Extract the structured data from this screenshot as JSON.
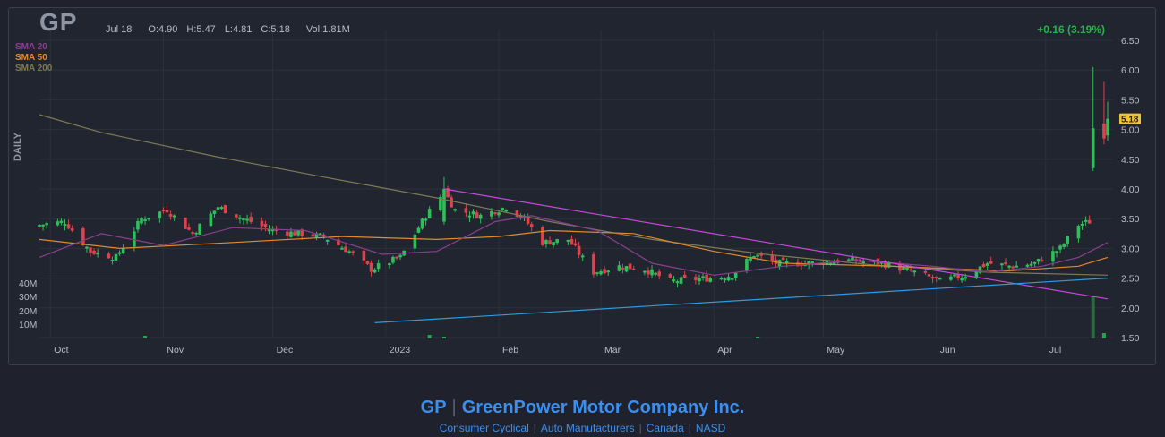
{
  "header": {
    "ticker": "GP",
    "date": "Jul 18",
    "open": "O:4.90",
    "high": "H:5.47",
    "low": "L:4.81",
    "close": "C:5.18",
    "volume": "Vol:1.81M",
    "change": "+0.16 (3.19%)",
    "timeframe": "DAILY"
  },
  "legend": [
    {
      "label": "SMA 20",
      "color": "#8a3f8f"
    },
    {
      "label": "SMA 50",
      "color": "#e08a2c"
    },
    {
      "label": "SMA 200",
      "color": "#7d7a55"
    }
  ],
  "footer": {
    "symbol": "GP",
    "company": "GreenPower Motor Company Inc.",
    "sector": "Consumer Cyclical",
    "industry": "Auto Manufacturers",
    "country": "Canada",
    "exchange": "NASD"
  },
  "colors": {
    "up": "#2fbf5a",
    "down": "#e0414d",
    "trendline_top": "#c64ad6",
    "trendline_bottom": "#2e9be0",
    "price_tag": "#f0c330"
  },
  "chart_data": {
    "type": "candlestick",
    "price_axis": {
      "ticks": [
        "6.50",
        "6.00",
        "5.50",
        "5.00",
        "4.50",
        "4.00",
        "3.50",
        "3.00",
        "2.50",
        "2.00",
        "1.50"
      ],
      "range": [
        1.5,
        6.5
      ]
    },
    "volume_axis": {
      "ticks": [
        "40M",
        "30M",
        "20M",
        "10M"
      ]
    },
    "x_labels": [
      "Oct",
      "Nov",
      "Dec",
      "2023",
      "Feb",
      "Mar",
      "Apr",
      "May",
      "Jun",
      "Jul"
    ],
    "last_price": "5.18",
    "anchors": [
      [
        "2022-09-28",
        3.4
      ],
      [
        "2022-10-05",
        3.45
      ],
      [
        "2022-10-12",
        2.95
      ],
      [
        "2022-10-19",
        2.85
      ],
      [
        "2022-10-26",
        3.5
      ],
      [
        "2022-11-02",
        3.65
      ],
      [
        "2022-11-09",
        3.25
      ],
      [
        "2022-11-16",
        3.7
      ],
      [
        "2022-11-23",
        3.5
      ],
      [
        "2022-12-01",
        3.3
      ],
      [
        "2022-12-08",
        3.25
      ],
      [
        "2022-12-15",
        3.2
      ],
      [
        "2022-12-22",
        2.95
      ],
      [
        "2022-12-28",
        2.65
      ],
      [
        "2023-01-05",
        2.85
      ],
      [
        "2023-01-12",
        3.55
      ],
      [
        "2023-01-17",
        3.95
      ],
      [
        "2023-01-20",
        3.65
      ],
      [
        "2023-01-27",
        3.55
      ],
      [
        "2023-02-03",
        3.7
      ],
      [
        "2023-02-08",
        3.5
      ],
      [
        "2023-02-13",
        3.1
      ],
      [
        "2023-02-20",
        3.15
      ],
      [
        "2023-02-27",
        2.6
      ],
      [
        "2023-03-06",
        2.7
      ],
      [
        "2023-03-13",
        2.65
      ],
      [
        "2023-03-20",
        2.45
      ],
      [
        "2023-03-31",
        2.5
      ],
      [
        "2023-04-06",
        2.55
      ],
      [
        "2023-04-12",
        2.9
      ],
      [
        "2023-04-18",
        2.75
      ],
      [
        "2023-04-26",
        2.75
      ],
      [
        "2023-05-08",
        2.8
      ],
      [
        "2023-05-17",
        2.75
      ],
      [
        "2023-05-26",
        2.6
      ],
      [
        "2023-06-02",
        2.45
      ],
      [
        "2023-06-09",
        2.55
      ],
      [
        "2023-06-15",
        2.75
      ],
      [
        "2023-06-22",
        2.7
      ],
      [
        "2023-06-28",
        2.75
      ],
      [
        "2023-07-05",
        3.0
      ],
      [
        "2023-07-10",
        3.4
      ],
      [
        "2023-07-13",
        3.45
      ],
      [
        "2023-07-14",
        4.9
      ],
      [
        "2023-07-17",
        5.02
      ],
      [
        "2023-07-18",
        5.18
      ]
    ],
    "sma20": [
      [
        "2022-09-28",
        2.85
      ],
      [
        "2022-10-15",
        3.25
      ],
      [
        "2022-11-01",
        3.05
      ],
      [
        "2022-11-20",
        3.35
      ],
      [
        "2022-12-10",
        3.3
      ],
      [
        "2022-12-31",
        2.9
      ],
      [
        "2023-01-15",
        2.95
      ],
      [
        "2023-01-31",
        3.45
      ],
      [
        "2023-02-10",
        3.55
      ],
      [
        "2023-02-28",
        3.3
      ],
      [
        "2023-03-15",
        2.75
      ],
      [
        "2023-04-01",
        2.55
      ],
      [
        "2023-04-20",
        2.7
      ],
      [
        "2023-05-10",
        2.8
      ],
      [
        "2023-05-31",
        2.7
      ],
      [
        "2023-06-15",
        2.6
      ],
      [
        "2023-06-30",
        2.7
      ],
      [
        "2023-07-10",
        2.85
      ],
      [
        "2023-07-18",
        3.1
      ]
    ],
    "sma50": [
      [
        "2022-09-28",
        3.15
      ],
      [
        "2022-10-20",
        3.0
      ],
      [
        "2022-11-20",
        3.1
      ],
      [
        "2022-12-20",
        3.2
      ],
      [
        "2023-01-15",
        3.15
      ],
      [
        "2023-02-01",
        3.2
      ],
      [
        "2023-02-15",
        3.3
      ],
      [
        "2023-03-10",
        3.25
      ],
      [
        "2023-04-01",
        2.95
      ],
      [
        "2023-04-20",
        2.75
      ],
      [
        "2023-05-20",
        2.7
      ],
      [
        "2023-06-20",
        2.62
      ],
      [
        "2023-07-10",
        2.7
      ],
      [
        "2023-07-18",
        2.85
      ]
    ],
    "sma200": [
      [
        "2022-09-28",
        5.25
      ],
      [
        "2022-10-15",
        4.95
      ],
      [
        "2022-11-15",
        4.55
      ],
      [
        "2022-12-15",
        4.2
      ],
      [
        "2023-01-15",
        3.85
      ],
      [
        "2023-02-15",
        3.45
      ],
      [
        "2023-03-15",
        3.15
      ],
      [
        "2023-04-15",
        2.9
      ],
      [
        "2023-05-15",
        2.72
      ],
      [
        "2023-06-15",
        2.6
      ],
      [
        "2023-07-18",
        2.55
      ]
    ],
    "trendlines": [
      {
        "name": "resistance",
        "from": [
          "2023-01-17",
          4.0
        ],
        "to": [
          "2023-07-18",
          2.15
        ]
      },
      {
        "name": "support",
        "from": [
          "2022-12-29",
          1.75
        ],
        "to": [
          "2023-07-18",
          2.5
        ]
      }
    ]
  }
}
